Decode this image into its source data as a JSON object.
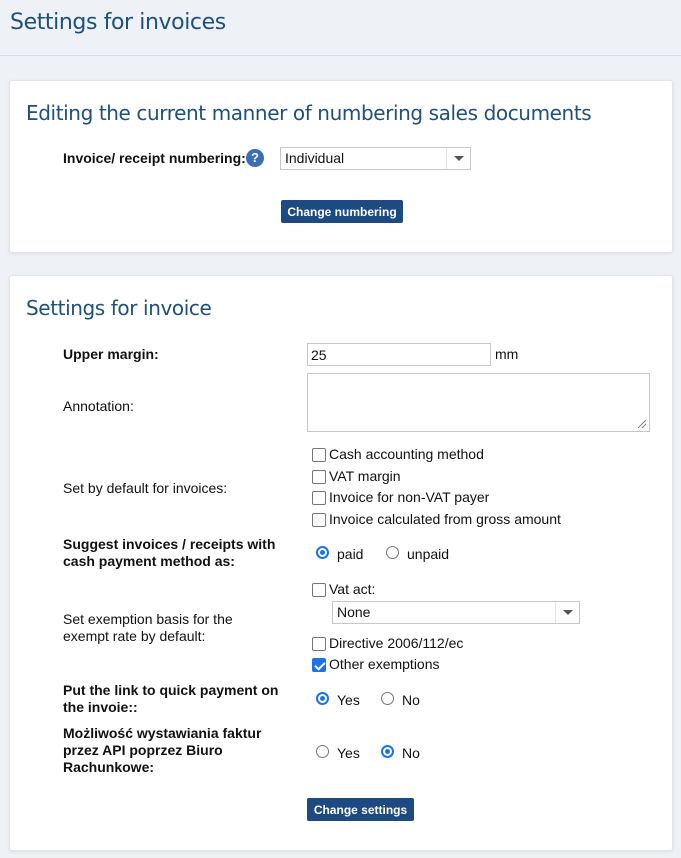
{
  "page": {
    "title": "Settings for invoices"
  },
  "numbering": {
    "title": "Editing the current manner of numbering sales documents",
    "label": "Invoice/ receipt numbering:",
    "help_icon": "question-circle-icon",
    "help_glyph": "?",
    "selected": "Individual",
    "button": "Change numbering"
  },
  "invoice": {
    "title": "Settings for invoice",
    "upper_margin": {
      "label": "Upper margin:",
      "value": "25",
      "unit": "mm"
    },
    "annotation": {
      "label": "Annotation:",
      "value": ""
    },
    "defaults": {
      "label": "Set by default for invoices:",
      "options": [
        {
          "label": "Cash accounting method",
          "checked": false
        },
        {
          "label": "VAT margin",
          "checked": false
        },
        {
          "label": "Invoice for non-VAT payer",
          "checked": false
        },
        {
          "label": "Invoice calculated from gross amount",
          "checked": false
        }
      ]
    },
    "cash_payment": {
      "label": "Suggest invoices / receipts with cash payment method as:",
      "options": [
        "paid",
        "unpaid"
      ],
      "selected": "paid"
    },
    "exemption": {
      "label": "Set exemption basis for the exempt rate by default:",
      "vat_act": {
        "label": "Vat act:",
        "checked": false
      },
      "vat_act_select": "None",
      "directive": {
        "label": "Directive 2006/112/ec",
        "checked": false
      },
      "other": {
        "label": "Other exemptions",
        "checked": true
      }
    },
    "quick_payment": {
      "label": "Put the link to quick payment on the invoie::",
      "options": [
        "Yes",
        "No"
      ],
      "selected": "Yes"
    },
    "api": {
      "label": "Możliwość wystawiania faktur przez API poprzez Biuro Rachunkowe:",
      "options": [
        "Yes",
        "No"
      ],
      "selected": "No"
    },
    "button": "Change settings"
  },
  "colors": {
    "accent": "#1e4a82",
    "title": "#1f4f7c",
    "check": "#1a73e8",
    "background": "#eef1f5"
  }
}
